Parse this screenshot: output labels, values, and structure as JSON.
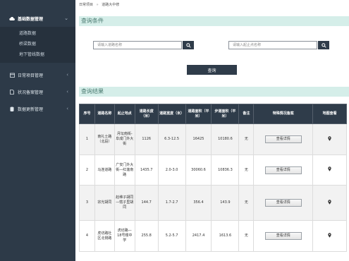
{
  "sidebar": {
    "groups": [
      {
        "label": "基础数据管理",
        "items": [
          "道路数据",
          "桥梁数据",
          "地下管线数据"
        ]
      },
      {
        "label": "日常项目管理"
      },
      {
        "label": "状况备案管理"
      },
      {
        "label": "数据更新管理"
      }
    ]
  },
  "breadcrumb": {
    "home": "日常项目",
    "sep": "»",
    "current": "道路大中修"
  },
  "query": {
    "title": "查询条件",
    "road_placeholder": "请输入道路名称",
    "range_placeholder": "请输入起止点名称",
    "button": "查询"
  },
  "results": {
    "title": "查询结果",
    "columns": [
      "序号",
      "道路名称",
      "起止地点",
      "道路长度（米）",
      "道路宽度（米）",
      "道路面积（平米）",
      "步道面积（平米）",
      "备注",
      "特殊情况备案",
      "地图查看"
    ],
    "detail_label": "查看详情",
    "rows": [
      {
        "no": "1",
        "name": "南礼士路（北段）",
        "range": "月坛南街-阜成门外大街",
        "length": "1126",
        "width": "6.3-12.5",
        "road_area": "16425",
        "walk_area": "10180.6",
        "note": "无"
      },
      {
        "no": "2",
        "name": "马连道路",
        "range": "广安门外大街—红莲南路",
        "length": "1435.7",
        "width": "2.0-3.0",
        "road_area": "30060.6",
        "walk_area": "10836.3",
        "note": "无"
      },
      {
        "no": "3",
        "name": "宗光胡同",
        "range": "赵维子胡同—辖子里胡同",
        "length": "144.7",
        "width": "1.7-2.7",
        "road_area": "356.4",
        "walk_area": "143.9",
        "note": "无"
      },
      {
        "no": "4",
        "name": "虎坊路社区北侧路",
        "range": "虎坊路—18号楼中学",
        "length": "255.8",
        "width": "5.2-5.7",
        "road_area": "2417.4",
        "walk_area": "1613.6",
        "note": "无"
      }
    ]
  },
  "colors": {
    "sidebar": "#2d3a48",
    "accent": "#2f3c4a",
    "section": "#d5eee9"
  }
}
